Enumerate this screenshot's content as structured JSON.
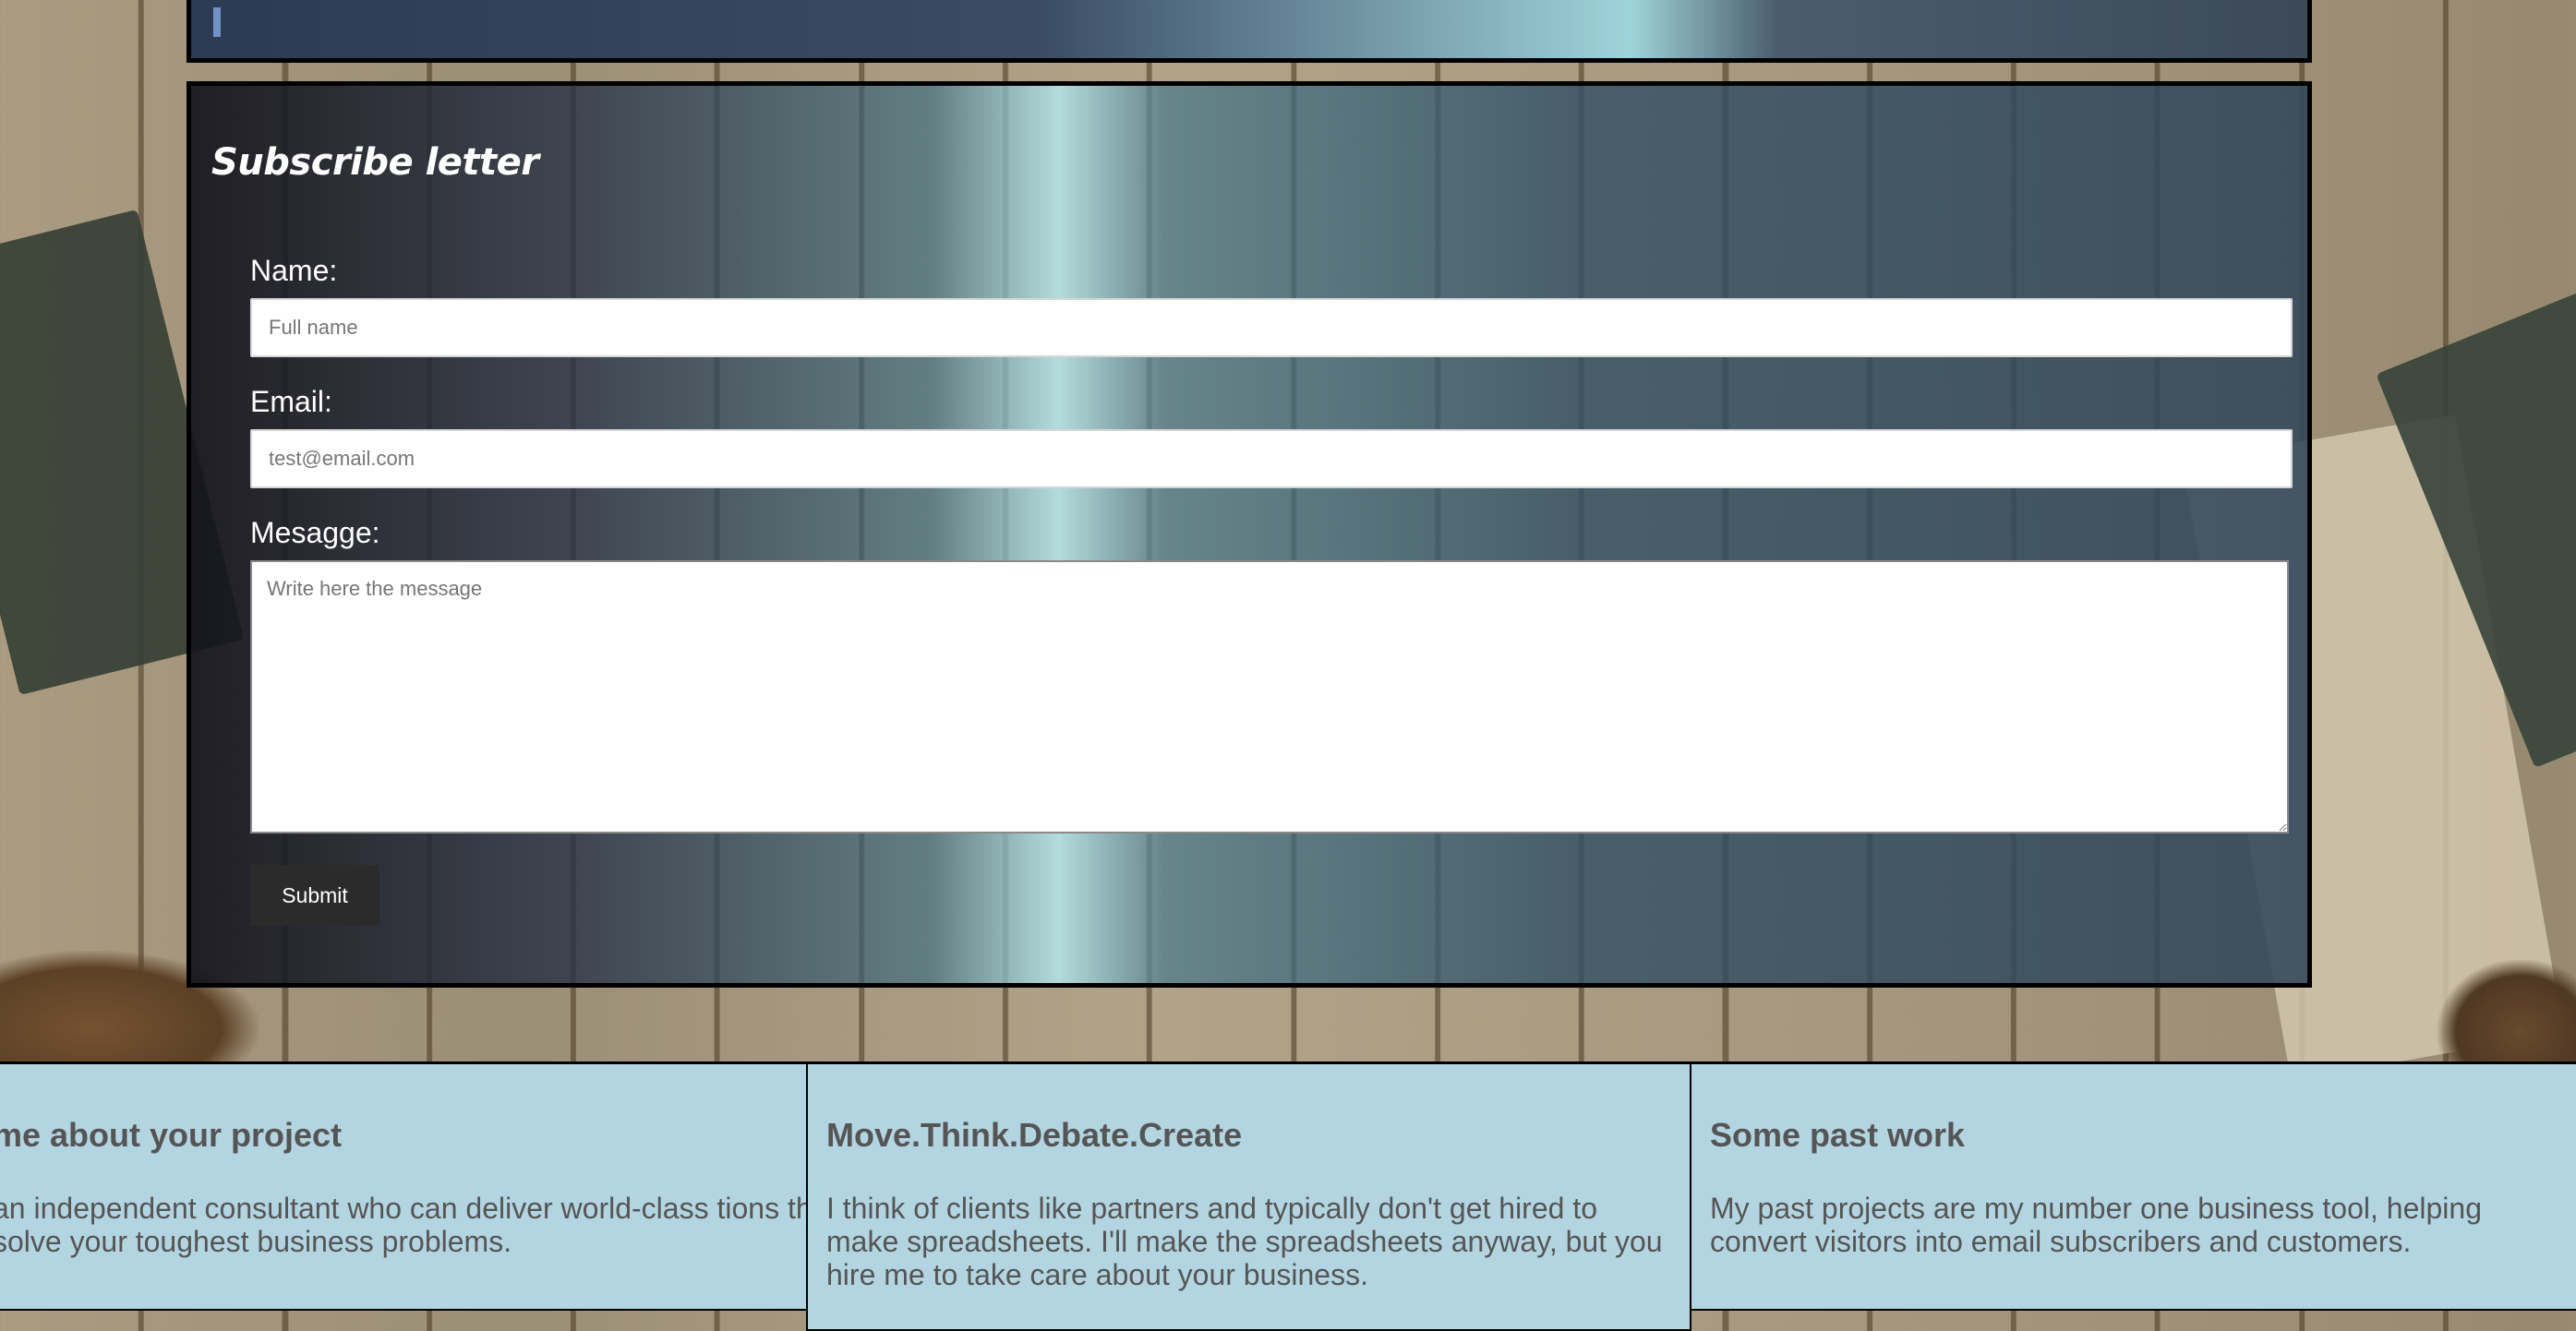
{
  "subscribe": {
    "title": "Subscribe letter",
    "name_label": "Name:",
    "name_placeholder": "Full name",
    "email_label": "Email:",
    "email_placeholder": "test@email.com",
    "message_label": "Mesagge:",
    "message_placeholder": "Write here the message",
    "submit_label": "Submit"
  },
  "cards": [
    {
      "title": " me about your project",
      "text": "an independent consultant who can deliver world-class tions that solve your toughest business problems."
    },
    {
      "title": "Move.Think.Debate.Create",
      "text": "I think of clients like partners and typically don't get hired to make spreadsheets. I'll make the spreadsheets anyway, but you hire me to take care about your business."
    },
    {
      "title": "Some past work",
      "text": "My past projects are my number one business tool, helping convert visitors into email subscribers and customers."
    }
  ]
}
